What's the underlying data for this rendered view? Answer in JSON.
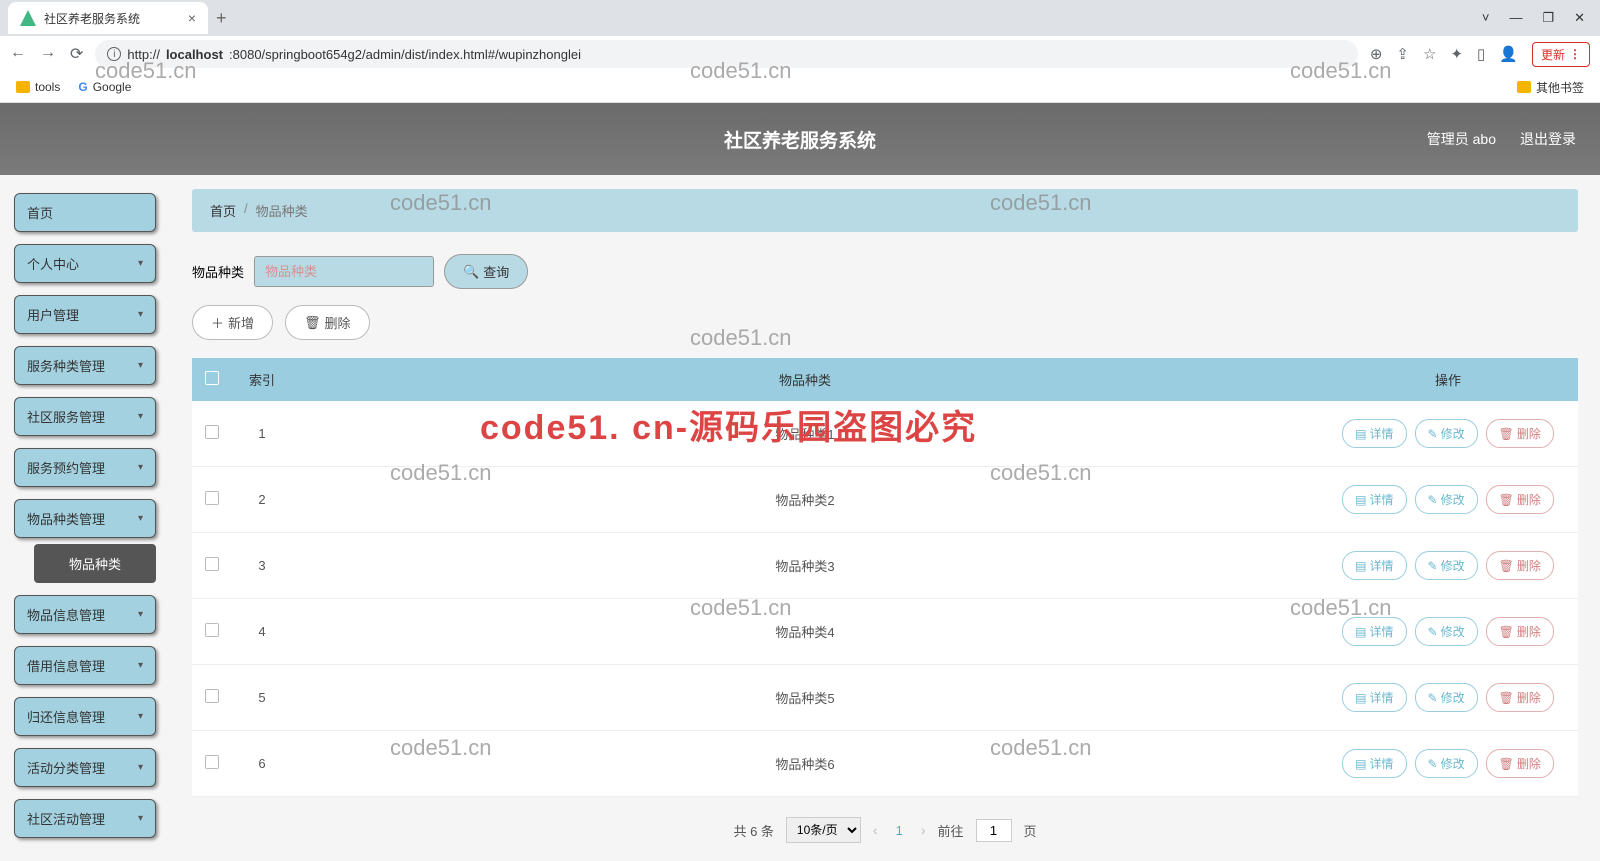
{
  "browser": {
    "tab_title": "社区养老服务系统",
    "url_prefix": "http://",
    "url_host": "localhost",
    "url_path": ":8080/springboot654g2/admin/dist/index.html#/wupinzhonglei",
    "update_label": "更新",
    "bookmarks": {
      "tools": "tools",
      "google": "Google",
      "other": "其他书签"
    }
  },
  "banner": {
    "title": "社区养老服务系统",
    "admin_label": "管理员 abo",
    "logout": "退出登录"
  },
  "sidebar": {
    "items": [
      "首页",
      "个人中心",
      "用户管理",
      "服务种类管理",
      "社区服务管理",
      "服务预约管理",
      "物品种类管理",
      "物品信息管理",
      "借用信息管理",
      "归还信息管理",
      "活动分类管理",
      "社区活动管理"
    ],
    "sub_item": "物品种类"
  },
  "breadcrumb": {
    "home": "首页",
    "current": "物品种类"
  },
  "search": {
    "label": "物品种类",
    "placeholder": "物品种类",
    "query": "查询"
  },
  "actions": {
    "add": "新增",
    "delete": "删除"
  },
  "table": {
    "cols": {
      "index": "索引",
      "name": "物品种类",
      "ops": "操作"
    },
    "ops": {
      "detail": "详情",
      "edit": "修改",
      "delete": "删除"
    },
    "rows": [
      {
        "idx": "1",
        "name": "物品种类1"
      },
      {
        "idx": "2",
        "name": "物品种类2"
      },
      {
        "idx": "3",
        "name": "物品种类3"
      },
      {
        "idx": "4",
        "name": "物品种类4"
      },
      {
        "idx": "5",
        "name": "物品种类5"
      },
      {
        "idx": "6",
        "name": "物品种类6"
      }
    ]
  },
  "pager": {
    "total": "共 6 条",
    "per_page": "10条/页",
    "page": "1",
    "goto": "前往",
    "goto_suffix": "页",
    "goto_val": "1"
  },
  "watermark": {
    "text": "code51.cn",
    "big": "code51. cn-源码乐园盗图必究"
  }
}
